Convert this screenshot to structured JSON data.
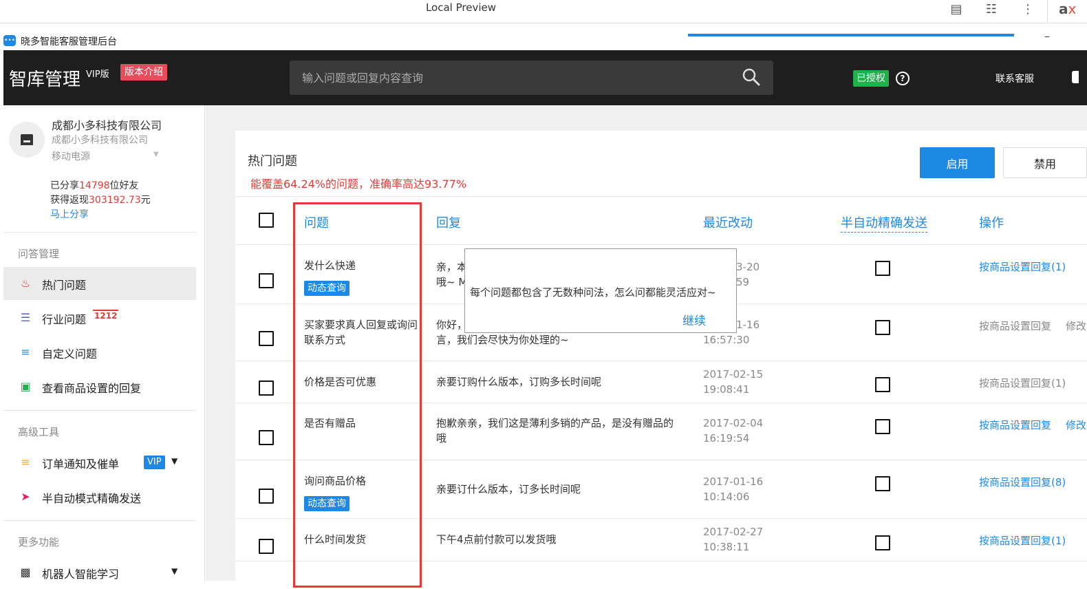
{
  "browser": {
    "title": "Local Preview",
    "brand_a": "a",
    "brand_b": "x",
    "icons": [
      "reader-icon",
      "reader-mode-icon",
      "more-icon"
    ]
  },
  "app": {
    "window_title": "晓多智能客服管理后台",
    "minimize": "–"
  },
  "header": {
    "title": "智库管理",
    "vip": "VIP版",
    "version_button": "版本介绍",
    "search_placeholder": "输入问题或回复内容查询",
    "authorized": "已授权",
    "help": "?",
    "contact": "联系客服"
  },
  "sidebar": {
    "company": "成都小多科技有限公司",
    "company_sub": "成都小多科技有限公司",
    "item_name": "移动电源",
    "shared_prefix": "已分享",
    "shared_count": "14798",
    "shared_suffix": "位好友",
    "rebate_prefix": "获得返现",
    "rebate_amount": "303192.73",
    "rebate_suffix": "元",
    "share_now": "马上分享",
    "groups": [
      "问答管理",
      "高级工具",
      "更多功能"
    ],
    "items": [
      {
        "label": "热门问题",
        "icon": "fire-icon"
      },
      {
        "label": "行业问题",
        "icon": "list-icon",
        "badge": "1212"
      },
      {
        "label": "自定义问题",
        "icon": "list-add-icon"
      },
      {
        "label": "查看商品设置的回复",
        "icon": "scan-icon"
      },
      {
        "label": "订单通知及催单",
        "icon": "list-check-icon",
        "badge": "VIP"
      },
      {
        "label": "半自动模式精确发送",
        "icon": "send-icon"
      },
      {
        "label": "机器人智能学习",
        "icon": "robot-icon"
      }
    ]
  },
  "main": {
    "section_title": "热门问题",
    "coverage": "能覆盖64.24%的问题，准确率高达93.77%",
    "enable": "启用",
    "disable": "禁用",
    "columns": [
      "问题",
      "回复",
      "最近改动",
      "半自动精确发送",
      "操作"
    ],
    "rows": [
      {
        "q": "发什么快递",
        "tag": "动态查询",
        "reply_1": "亲，本",
        "reply_2": "哦~ M",
        "date": "3-20",
        "time": "59",
        "op": "按商品设置回复(1)",
        "op_gray": false,
        "op2": ""
      },
      {
        "q_1": "买家要求真人回复或询问",
        "q_2": "联系方式",
        "reply_1": "你好，",
        "reply_2": "言，我们会尽快为你处理的~",
        "date": "1-16",
        "time": "16:57:30",
        "op": "按商品设置回复",
        "op_gray": true,
        "op2": "修改"
      },
      {
        "q": "价格是否可优惠",
        "reply": "亲要订购什么版本，订购多长时间呢",
        "date": "2017-02-15",
        "time": "19:08:41",
        "op": "按商品设置回复(1)",
        "op_gray": true,
        "op2": ""
      },
      {
        "q": "是否有赠品",
        "reply_1": "抱歉亲亲，我们这是薄利多销的产品，是没有赠品的",
        "reply_2": "哦",
        "date": "2017-02-04",
        "time": "16:19:54",
        "op": "按商品设置回复",
        "op_gray": false,
        "op2": "修改"
      },
      {
        "q": "询问商品价格",
        "tag": "动态查询",
        "reply": "亲要订什么版本，订多长时间呢",
        "date": "2017-01-16",
        "time": "10:14:06",
        "op": "按商品设置回复(8)",
        "op_gray": false,
        "op2": ""
      },
      {
        "q": "什么时间发货",
        "reply": "下午4点前付款可以发货哦",
        "date": "2017-02-27",
        "time": "10:38:11",
        "op": "按商品设置回复(1)",
        "op_gray": false,
        "op2": ""
      }
    ]
  },
  "popup": {
    "message": "每个问题都包含了无数种问法，怎么问都能灵活应对~",
    "continue": "继续"
  },
  "colors": {
    "accent": "#1e88e5",
    "header_bg": "#1e1e1e",
    "highlight_red": "#e53935",
    "authorized_green": "#21b14b"
  }
}
